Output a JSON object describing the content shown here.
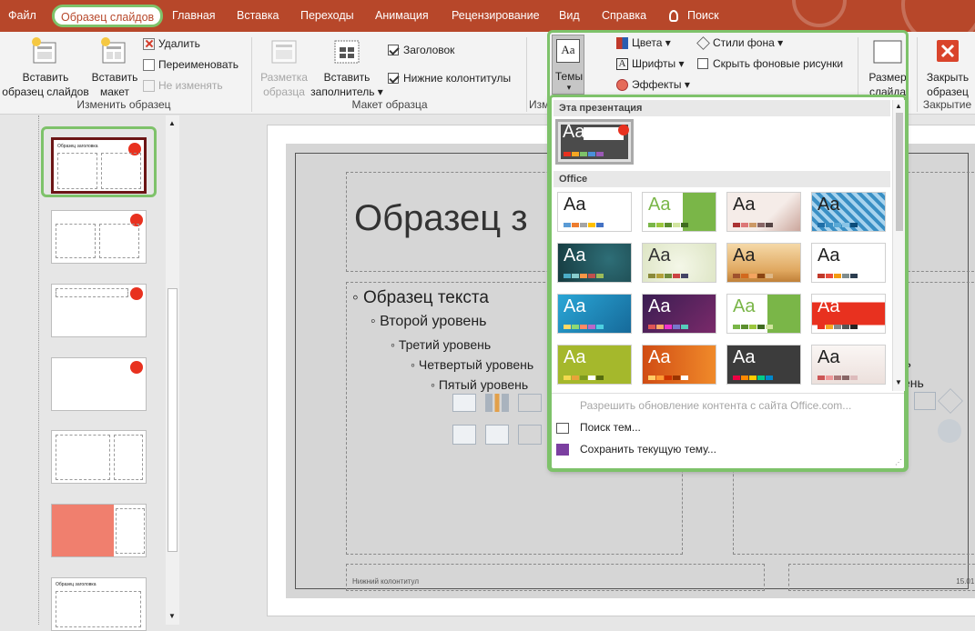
{
  "tabs": [
    "Файл",
    "Образец слайдов",
    "Главная",
    "Вставка",
    "Переходы",
    "Анимация",
    "Рецензирование",
    "Вид",
    "Справка",
    "Поиск"
  ],
  "ribbon": {
    "insert_master": [
      "Вставить",
      "образец слайдов"
    ],
    "insert_layout": [
      "Вставить",
      "макет"
    ],
    "delete": "Удалить",
    "rename": "Переименовать",
    "preserve": "Не изменять",
    "group_edit": "Изменить образец",
    "master_layout": [
      "Разметка",
      "образца"
    ],
    "insert_placeholder": [
      "Вставить",
      "заполнитель"
    ],
    "title_check": "Заголовок",
    "footers_check": "Нижние колонтитулы",
    "group_layout": "Макет образца",
    "group_edit_theme_partial": "Изм",
    "themes": "Темы",
    "colors": "Цвета",
    "fonts": "Шрифты",
    "effects": "Эффекты",
    "bg_styles": "Стили фона",
    "hide_bg": "Скрыть фоновые рисунки",
    "slide_size": [
      "Размер",
      "слайда"
    ],
    "close_master": [
      "Закрыть",
      "образец"
    ],
    "group_close": "Закрытие"
  },
  "slide": {
    "title": "Образец з",
    "level1": "Образец текста",
    "level2": "Второй уровень",
    "level3": "Третий уровень",
    "level4": "Четвертый уровень",
    "level5": "Пятый уровень",
    "right_l4": "ень",
    "right_l5": "ень",
    "footer": "Нижний колонтитул",
    "date": "15.01.2"
  },
  "themes_panel": {
    "section_this": "Эта презентация",
    "section_office": "Office",
    "aa": "Aa",
    "menu": [
      "Разрешить обновление контента с сайта Office.com...",
      "Поиск тем...",
      "Сохранить текущую тему..."
    ]
  },
  "thumb_texts": {
    "title": "Образец заголовка",
    "title2": "Образец заголовка"
  },
  "colors": {
    "accent": "#b7472a",
    "highlight": "#7ec26a",
    "theme_red": "#e8311f"
  }
}
